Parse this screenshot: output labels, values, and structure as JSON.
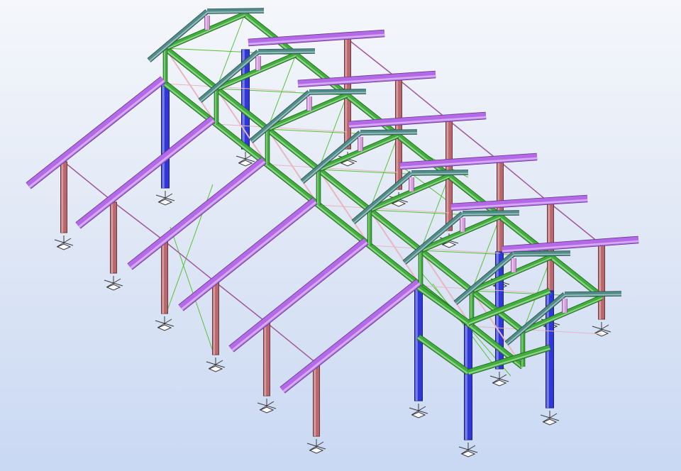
{
  "model": {
    "background_top": "#f5f7fb",
    "background_bottom": "#c9d8f3",
    "colors": {
      "steel_column_blue": "#2f38d6",
      "steel_column_red": "#b9666c",
      "rafter_purple": "#b469e8",
      "truss_green": "#3fae3a",
      "truss_chord_teal": "#4f8d8a",
      "truss_web_pink": "#e7b7c0",
      "post_pink": "#d99adf",
      "bracing_green": "#55c236",
      "tie_purple": "#a05a9c",
      "support_symbol": "#3a3a3a"
    },
    "icons": [
      "fixed-support-icon"
    ]
  }
}
